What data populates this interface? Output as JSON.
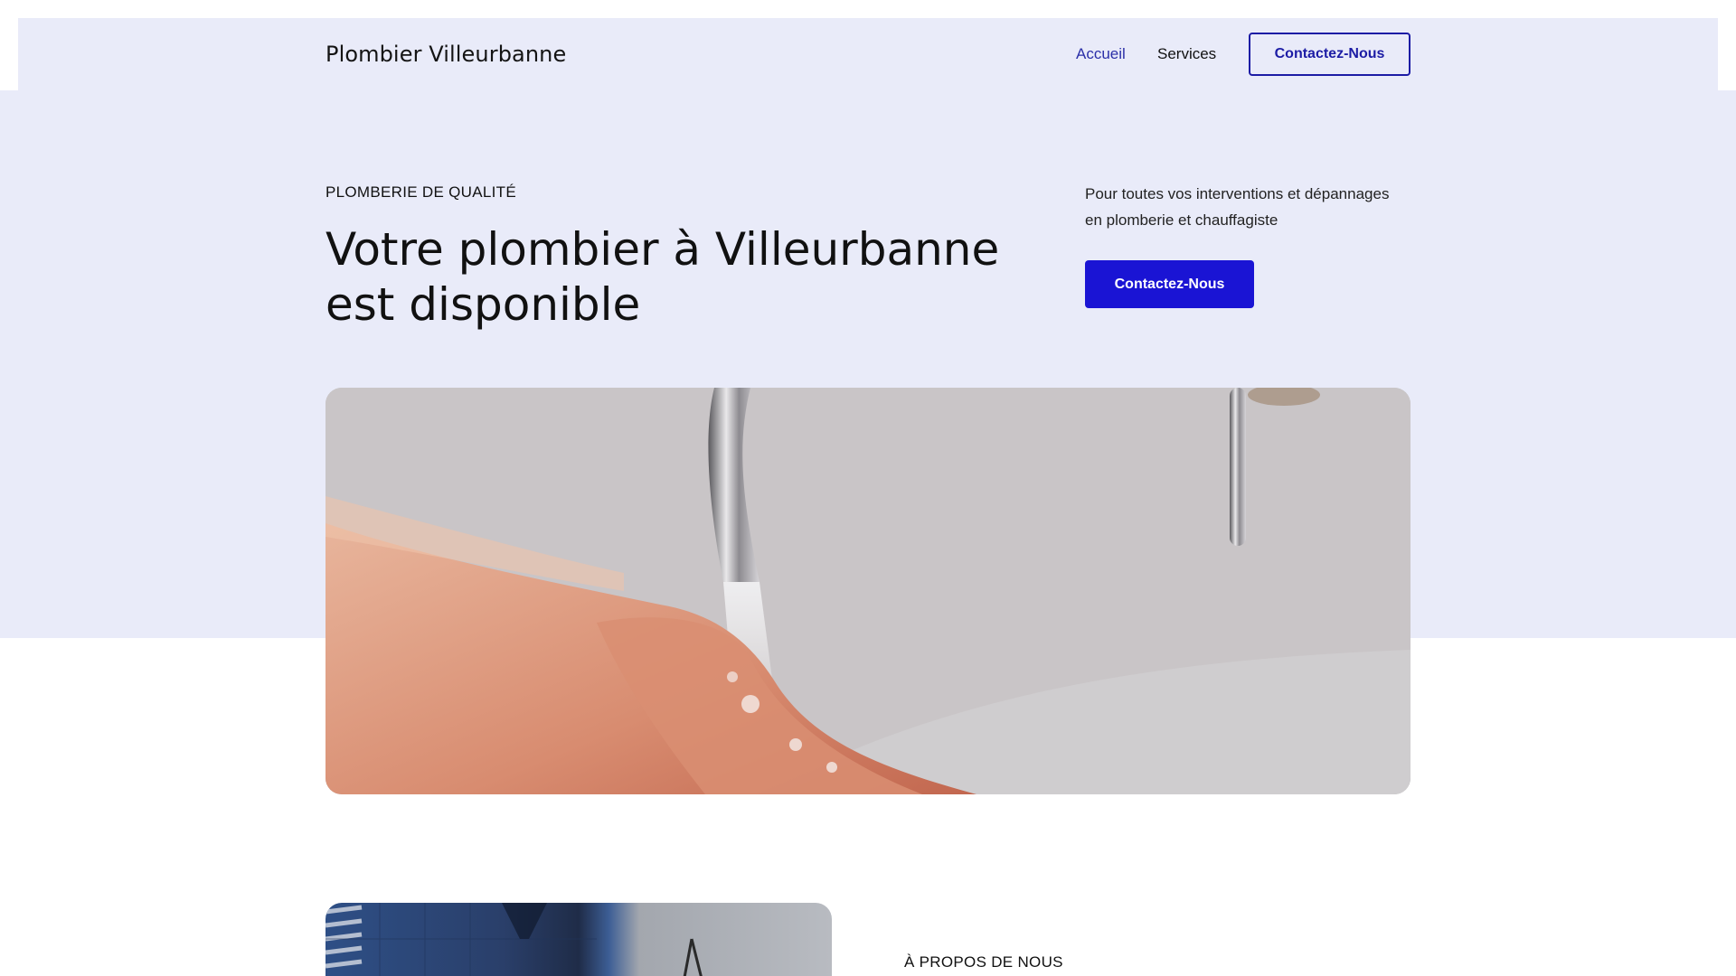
{
  "header": {
    "brand": "Plombier Villeurbanne",
    "nav": [
      {
        "label": "Accueil",
        "active": true
      },
      {
        "label": "Services",
        "active": false
      }
    ],
    "cta_label": "Contactez-Nous"
  },
  "hero": {
    "eyebrow": "PLOMBERIE DE QUALITÉ",
    "title": "Votre plombier à Villeurbanne est disponible",
    "description": "Pour toutes vos interventions et dépannages en plomberie et chauffagiste",
    "cta_label": "Contactez-Nous"
  },
  "about": {
    "eyebrow": "À PROPOS DE NOUS"
  },
  "colors": {
    "hero_background": "#e9ebf9",
    "primary": "#1a14d4",
    "nav_active": "#2b2fa8",
    "outline_button": "#1c1ca5"
  },
  "icons": []
}
